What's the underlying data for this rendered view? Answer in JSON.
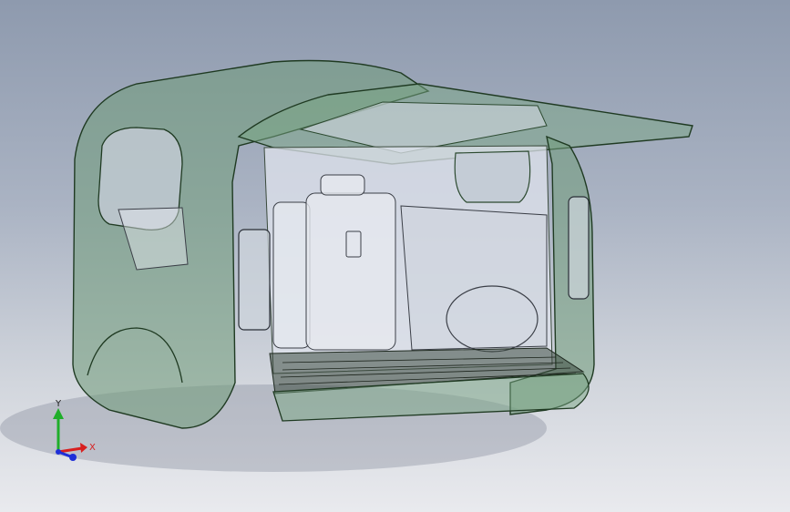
{
  "viewport": {
    "background_top": "#8e9aae",
    "background_bottom": "#e9eaee",
    "model_fill": "#5f8a6a",
    "model_edge": "#1f3a22",
    "interior_fill": "#dfe3ec"
  },
  "triad": {
    "x_label": "X",
    "y_label": "Y",
    "x_color": "#d81f1f",
    "y_color": "#1fae2a",
    "z_color": "#1f2fd8"
  }
}
